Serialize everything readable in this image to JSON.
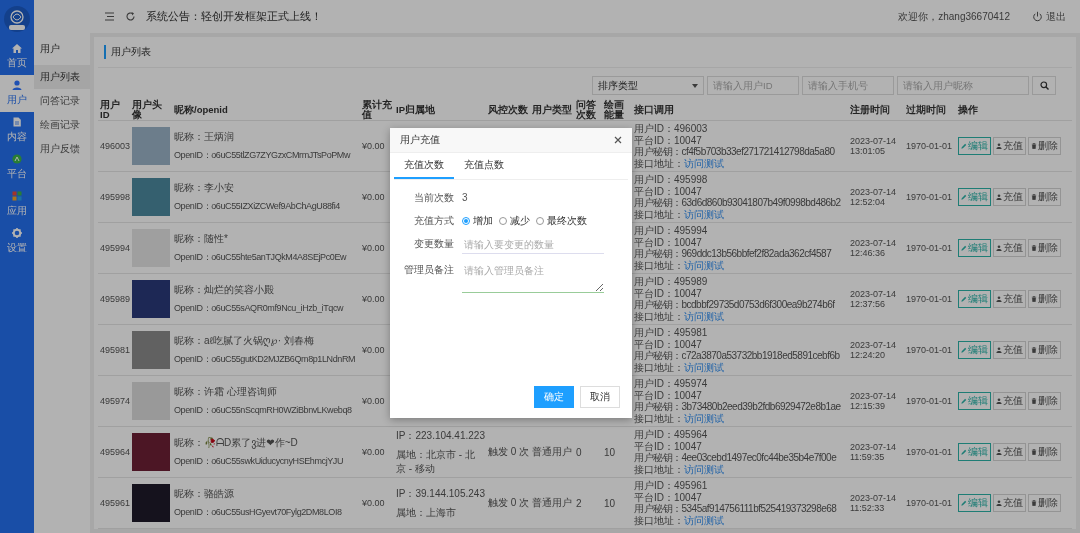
{
  "sidebar": {
    "items": [
      {
        "label": "首页",
        "selected": false
      },
      {
        "label": "用户",
        "selected": true
      },
      {
        "label": "内容",
        "selected": false
      },
      {
        "label": "平台",
        "selected": false
      },
      {
        "label": "应用",
        "selected": false
      },
      {
        "label": "设置",
        "selected": false
      }
    ]
  },
  "subnav": {
    "title": "用户",
    "items": [
      {
        "label": "用户列表",
        "selected": true
      },
      {
        "label": "问答记录",
        "selected": false
      },
      {
        "label": "绘画记录",
        "selected": false
      },
      {
        "label": "用户反馈",
        "selected": false
      }
    ]
  },
  "topbar": {
    "notice": "系统公告：轻创开发框架正式上线！",
    "welcome": "欢迎你，zhang36670412",
    "logout": "退出"
  },
  "panel": {
    "title": "用户列表"
  },
  "filters": {
    "sort": {
      "value": "排序类型"
    },
    "fields": [
      {
        "placeholder": "请输入用户ID"
      },
      {
        "placeholder": "请输入手机号"
      },
      {
        "placeholder": "请输入用户昵称"
      }
    ]
  },
  "table": {
    "columns": [
      "用户ID",
      "用户头像",
      "昵称/openid",
      "累计充值",
      "IP归属地",
      "风控次数",
      "用户类型",
      "问答次数",
      "绘画能量",
      "接口调用",
      "注册时间",
      "过期时间",
      "操作"
    ],
    "rows": [
      {
        "id": "496003",
        "nickname": "昵称：王炳润",
        "openid": "OpenID：o6uC55tlZG7ZYGzxCMrmJTsPoPMw",
        "balance": "¥0.00",
        "api": {
          "user_id": "用户ID：496003",
          "platform_id": "平台ID：10047",
          "secret": "用户秘钥：cf4f5b703b33ef271721412798da5a80",
          "address": "接口地址：",
          "link": "访问测试"
        },
        "registered": "2023-07-14 13:01:05",
        "expires": "1970-01-01",
        "actions": [
          {
            "kind": "edit",
            "label": "编辑"
          },
          {
            "kind": "recharge",
            "label": "充值"
          },
          {
            "kind": "delete",
            "label": "删除"
          }
        ]
      },
      {
        "id": "495998",
        "nickname": "昵称：李小安",
        "openid": "OpenID：o6uC55IZXiZCWef9AbChAgU88fi4",
        "balance": "¥0.00",
        "api": {
          "user_id": "用户ID：495998",
          "platform_id": "平台ID：10047",
          "secret": "用户秘钥：63d6d860b93041807b49f0998bd486b2",
          "address": "接口地址：",
          "link": "访问测试"
        },
        "registered": "2023-07-14 12:52:04",
        "expires": "1970-01-01",
        "actions": [
          {
            "kind": "edit",
            "label": "编辑"
          },
          {
            "kind": "recharge",
            "label": "充值"
          },
          {
            "kind": "delete",
            "label": "删除"
          }
        ]
      },
      {
        "id": "495994",
        "nickname": "昵称：随性*",
        "openid": "OpenID：o6uC55hte5anTJQkM4A8SEjPc0Ew",
        "balance": "¥0.00",
        "api": {
          "user_id": "用户ID：495994",
          "platform_id": "平台ID：10047",
          "secret": "用户秘钥：969ddc13b56bbfef2f82ada362cf4587",
          "address": "接口地址：",
          "link": "访问测试"
        },
        "registered": "2023-07-14 12:46:36",
        "expires": "1970-01-01",
        "actions": [
          {
            "kind": "edit",
            "label": "编辑"
          },
          {
            "kind": "recharge",
            "label": "充值"
          },
          {
            "kind": "delete",
            "label": "删除"
          }
        ]
      },
      {
        "id": "495989",
        "nickname": "昵称：灿烂的笑容小殿",
        "openid": "OpenID：o6uC55sAQR0mf9Ncu_iHzb_iTqcw",
        "balance": "¥0.00",
        "api": {
          "user_id": "用户ID：495989",
          "platform_id": "平台ID：10047",
          "secret": "用户秘钥：bcdbbf29735d0753d6f300ea9b274b6f",
          "address": "接口地址：",
          "link": "访问测试"
        },
        "registered": "2023-07-14 12:37:56",
        "expires": "1970-01-01",
        "actions": [
          {
            "kind": "edit",
            "label": "编辑"
          },
          {
            "kind": "recharge",
            "label": "充值"
          },
          {
            "kind": "delete",
            "label": "删除"
          }
        ]
      },
      {
        "id": "495981",
        "nickname": "昵称：aℓ吃腻了火锅ღ℘· 刘春梅",
        "openid": "OpenID：o6uC55gutKD2MJZB6Qm8p1LNdnRM",
        "balance": "¥0.00",
        "api": {
          "user_id": "用户ID：495981",
          "platform_id": "平台ID：10047",
          "secret": "用户秘钥：c72a3870a53732bb1918ed5891cebf6b",
          "address": "接口地址：",
          "link": "访问测试"
        },
        "registered": "2023-07-14 12:24:20",
        "expires": "1970-01-01",
        "actions": [
          {
            "kind": "edit",
            "label": "编辑"
          },
          {
            "kind": "recharge",
            "label": "充值"
          },
          {
            "kind": "delete",
            "label": "删除"
          }
        ]
      },
      {
        "id": "495974",
        "nickname": "昵称：许霜 心理咨询师",
        "openid": "OpenID：o6uC55nScqmRH0WZiBbnvLKwebq8",
        "balance": "¥0.00",
        "api": {
          "user_id": "用户ID：495974",
          "platform_id": "平台ID：10047",
          "secret": "用户秘钥：3b73480b2eed39b2fdb6929472e8b1ae",
          "address": "接口地址：",
          "link": "访问测试"
        },
        "registered": "2023-07-14 12:15:39",
        "expires": "1970-01-01",
        "actions": [
          {
            "kind": "edit",
            "label": "编辑"
          },
          {
            "kind": "recharge",
            "label": "充值"
          },
          {
            "kind": "delete",
            "label": "删除"
          }
        ]
      },
      {
        "id": "495964",
        "nickname": "昵称：🥀ᗩD累了ვ进❤作~D",
        "openid": "OpenID：o6uC55swkUiducycnyHSEhmcjYJU",
        "balance": "¥0.00",
        "ip": "IP：223.104.41.223",
        "location": "属地：北京市 - 北京 - 移动",
        "risk": "触发 0 次",
        "user_type": "普通用户",
        "qa": "0",
        "draw": "10",
        "api": {
          "user_id": "用户ID：495964",
          "platform_id": "平台ID：10047",
          "secret": "用户秘钥：4ee03cebd1497ec0fc44be35b4e7f00e",
          "address": "接口地址：",
          "link": "访问测试"
        },
        "registered": "2023-07-14 11:59:35",
        "expires": "1970-01-01",
        "actions": [
          {
            "kind": "edit",
            "label": "编辑"
          },
          {
            "kind": "recharge",
            "label": "充值"
          },
          {
            "kind": "delete",
            "label": "删除"
          }
        ]
      },
      {
        "id": "495961",
        "nickname": "昵称：骆皓源",
        "openid": "OpenID：o6uC55usHGyevt70Fylg2DM8LOI8",
        "balance": "¥0.00",
        "ip": "IP：39.144.105.243",
        "location": "属地：上海市",
        "risk": "触发 0 次",
        "user_type": "普通用户",
        "qa": "2",
        "draw": "10",
        "api": {
          "user_id": "用户ID：495961",
          "platform_id": "平台ID：10047",
          "secret": "用户秘钥：5345af914756111bf525419373298e68",
          "address": "接口地址：",
          "link": "访问测试"
        },
        "registered": "2023-07-14 11:52:33",
        "expires": "1970-01-01",
        "actions": [
          {
            "kind": "edit",
            "label": "编辑"
          },
          {
            "kind": "recharge",
            "label": "充值"
          },
          {
            "kind": "delete",
            "label": "删除"
          }
        ]
      }
    ]
  },
  "dialog": {
    "title": "用户充值",
    "tabs": [
      {
        "label": "充值次数",
        "selected": true
      },
      {
        "label": "充值点数",
        "selected": false
      }
    ],
    "fields": [
      {
        "kind": "readonly",
        "label": "当前次数",
        "value": "3"
      },
      {
        "kind": "radio",
        "label": "充值方式",
        "options": [
          {
            "label": "增加",
            "selected": true
          },
          {
            "label": "减少",
            "selected": false
          },
          {
            "label": "最终次数",
            "selected": false
          }
        ]
      },
      {
        "kind": "input",
        "label": "变更数量",
        "placeholder": "请输入要变更的数量"
      },
      {
        "kind": "textarea",
        "label": "管理员备注",
        "placeholder": "请输入管理员备注"
      }
    ],
    "buttons": [
      {
        "kind": "primary",
        "label": "确定"
      },
      {
        "kind": "default",
        "label": "取消"
      }
    ]
  }
}
